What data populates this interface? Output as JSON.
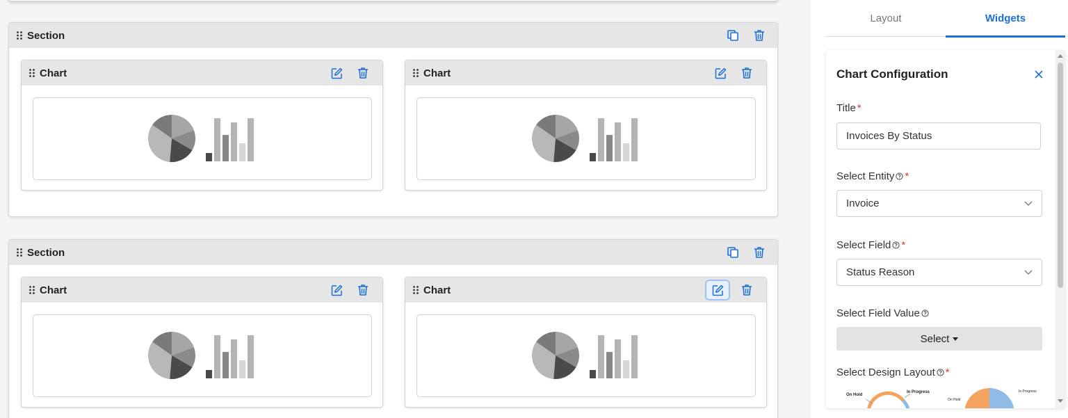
{
  "canvas": {
    "sections": [
      {
        "title": "Section",
        "charts": [
          {
            "title": "Chart"
          },
          {
            "title": "Chart"
          }
        ]
      },
      {
        "title": "Section",
        "charts": [
          {
            "title": "Chart"
          },
          {
            "title": "Chart"
          }
        ]
      }
    ],
    "icons": {
      "copy": "copy-icon",
      "delete": "trash-icon",
      "edit": "edit-icon",
      "drag": "drag-handle-icon",
      "placeholder": "chart-placeholder-icon"
    },
    "accent": "#1a6fd8"
  },
  "panel": {
    "tabs": [
      {
        "label": "Layout",
        "active": false
      },
      {
        "label": "Widgets",
        "active": true
      }
    ],
    "config": {
      "title": "Chart Configuration",
      "title_field": {
        "label": "Title",
        "required_mark": "*",
        "value": "Invoices By Status"
      },
      "entity_field": {
        "label": "Select Entity",
        "required_mark": "*",
        "value": "Invoice"
      },
      "field_field": {
        "label": "Select Field",
        "required_mark": "*",
        "value": "Status Reason"
      },
      "field_value": {
        "label": "Select Field Value",
        "button_label": "Select"
      },
      "design_layout": {
        "label": "Select Design Layout",
        "required_mark": "*",
        "preview_labels": [
          "On Hold",
          "In Progress",
          "On Hold",
          "In Progress"
        ]
      }
    }
  }
}
